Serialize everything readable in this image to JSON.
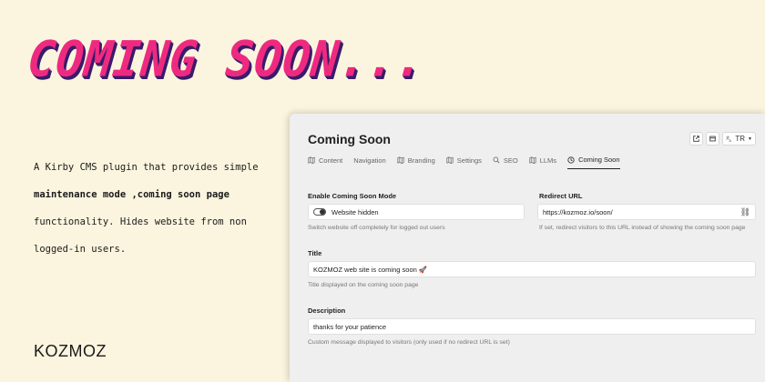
{
  "hero": {
    "title": "COMING SOON..."
  },
  "intro": {
    "line1": "A Kirby CMS plugin that provides simple",
    "line2": "maintenance mode ,coming soon page",
    "line3": "functionality. Hides website from non",
    "line4": "logged-in users."
  },
  "brand": {
    "logo": "KOZMOZ"
  },
  "panel": {
    "title": "Coming Soon",
    "actions": {
      "language": "TR"
    },
    "tabs": [
      {
        "label": "Content",
        "icon": "map-icon"
      },
      {
        "label": "Navigation",
        "icon": ""
      },
      {
        "label": "Branding",
        "icon": "map-icon"
      },
      {
        "label": "Settings",
        "icon": "map-icon"
      },
      {
        "label": "SEO",
        "icon": "search-icon"
      },
      {
        "label": "LLMs",
        "icon": "map-icon"
      },
      {
        "label": "Coming Soon",
        "icon": "clock-icon"
      }
    ],
    "fields": {
      "mode": {
        "label": "Enable Coming Soon Mode",
        "value": "Website hidden",
        "help": "Switch website off completely for logged out users"
      },
      "redirect": {
        "label": "Redirect URL",
        "value": "https://kozmoz.io/soon/",
        "help": "If set, redirect visitors to this URL instead of showing the coming soon page"
      },
      "title": {
        "label": "Title",
        "value": "KOZMOZ web site is coming soon 🚀",
        "help": "Title displayed on the coming soon page"
      },
      "description": {
        "label": "Description",
        "value": "thanks for your patience",
        "help": "Custom message displayed to visitors (only used if no redirect URL is set)"
      }
    }
  },
  "colors": {
    "hero": "#ee2a80",
    "heroShadow": "#3a1b6a",
    "background": "#fbf5df",
    "panel": "#efefef"
  }
}
